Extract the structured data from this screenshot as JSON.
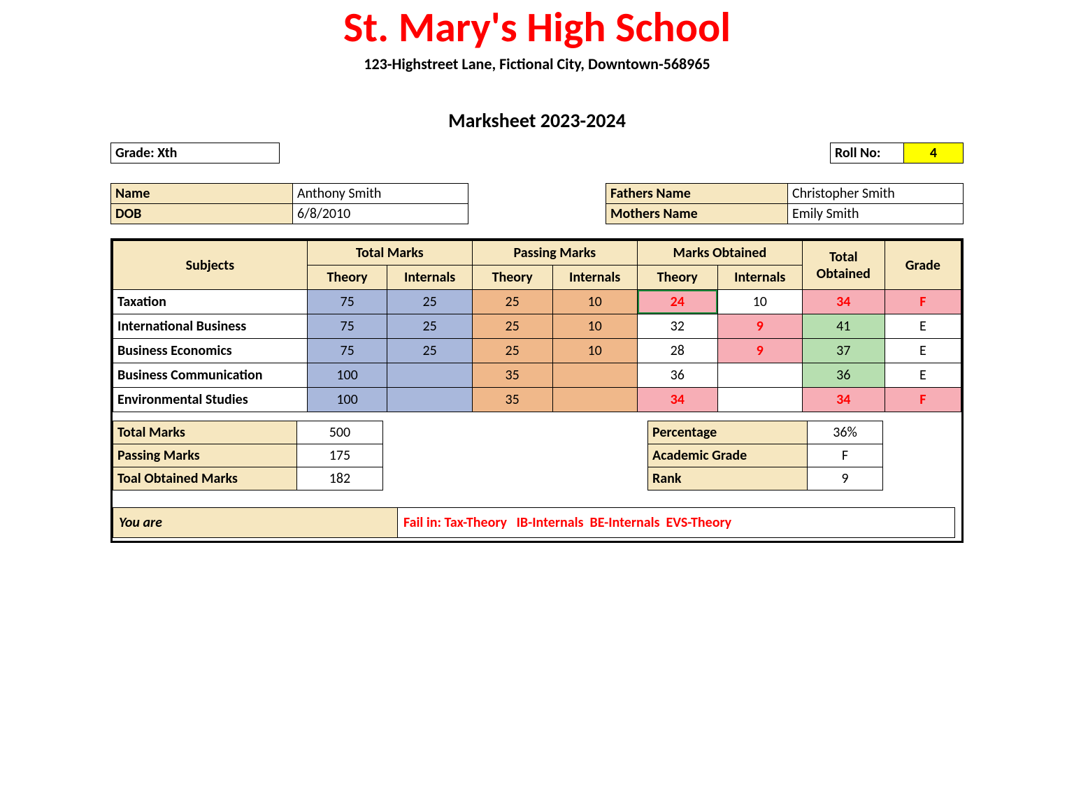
{
  "header": {
    "school_name": "St. Mary's High School",
    "address": "123-Highstreet Lane, Fictional City, Downtown-568965",
    "title": "Marksheet 2023-2024"
  },
  "top": {
    "grade": "Grade: Xth",
    "roll_label": "Roll No:",
    "roll_value": "4"
  },
  "student": {
    "name_label": "Name",
    "name": "Anthony Smith",
    "dob_label": "DOB",
    "dob": "6/8/2010"
  },
  "parents": {
    "father_label": "Fathers Name",
    "father": "Christopher Smith",
    "mother_label": "Mothers Name",
    "mother": "Emily Smith"
  },
  "cols": {
    "subjects": "Subjects",
    "total_marks": "Total Marks",
    "passing_marks": "Passing Marks",
    "marks_obtained": "Marks Obtained",
    "total_obtained": "Total Obtained",
    "grade": "Grade",
    "theory": "Theory",
    "internals": "Internals"
  },
  "rows": [
    {
      "subject": "Taxation",
      "tm_th": "75",
      "tm_in": "25",
      "pm_th": "25",
      "pm_in": "10",
      "ob_th": "24",
      "ob_th_cls": "bg-pink redtxt",
      "ob_th_sel": true,
      "ob_in": "10",
      "ob_in_cls": "",
      "tot": "34",
      "tot_cls": "bg-pink redtxt",
      "grade": "F",
      "grade_cls": "bg-pink redtxt"
    },
    {
      "subject": "International Business",
      "tm_th": "75",
      "tm_in": "25",
      "pm_th": "25",
      "pm_in": "10",
      "ob_th": "32",
      "ob_th_cls": "",
      "ob_in": "9",
      "ob_in_cls": "bg-pink redtxt",
      "tot": "41",
      "tot_cls": "bg-green",
      "grade": "E",
      "grade_cls": ""
    },
    {
      "subject": "Business Economics",
      "tm_th": "75",
      "tm_in": "25",
      "pm_th": "25",
      "pm_in": "10",
      "ob_th": "28",
      "ob_th_cls": "",
      "ob_in": "9",
      "ob_in_cls": "bg-pink redtxt",
      "tot": "37",
      "tot_cls": "bg-green",
      "grade": "E",
      "grade_cls": ""
    },
    {
      "subject": "Business Communication",
      "tm_th": "100",
      "tm_in": "",
      "pm_th": "35",
      "pm_in": "",
      "ob_th": "36",
      "ob_th_cls": "",
      "ob_in": "",
      "ob_in_cls": "",
      "tot": "36",
      "tot_cls": "bg-green",
      "grade": "E",
      "grade_cls": ""
    },
    {
      "subject": "Environmental Studies",
      "tm_th": "100",
      "tm_in": "",
      "pm_th": "35",
      "pm_in": "",
      "ob_th": "34",
      "ob_th_cls": "bg-pink redtxt",
      "ob_in": "",
      "ob_in_cls": "",
      "tot": "34",
      "tot_cls": "bg-pink redtxt",
      "grade": "F",
      "grade_cls": "bg-pink redtxt"
    }
  ],
  "summary_left": {
    "total_marks_label": "Total Marks",
    "total_marks": "500",
    "passing_label": "Passing Marks",
    "passing": "175",
    "obtained_label": "Toal Obtained Marks",
    "obtained": "182"
  },
  "summary_right": {
    "percentage_label": "Percentage",
    "percentage": "36%",
    "ac_grade_label": "Academic  Grade",
    "ac_grade": "F",
    "rank_label": "Rank",
    "rank": "9"
  },
  "result": {
    "you_are_label": "You are",
    "text": "Fail in: Tax-Theory   IB-Internals  BE-Internals  EVS-Theory"
  }
}
